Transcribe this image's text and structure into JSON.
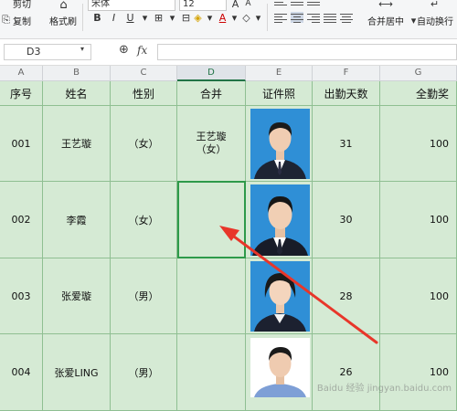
{
  "ribbon": {
    "cut_label": "剪切",
    "copy_label": "复制",
    "format_painter_label": "格式刷",
    "font_name": "宋体",
    "font_size": "12",
    "merge_center_label": "合并居中",
    "auto_wrap_label": "自动换行"
  },
  "formula_bar": {
    "name_box": "D3",
    "fx_symbol": "fx",
    "formula": ""
  },
  "columns": [
    "A",
    "B",
    "C",
    "D",
    "E",
    "F",
    "G"
  ],
  "table": {
    "headers": [
      "序号",
      "姓名",
      "性别",
      "合并",
      "证件照",
      "出勤天数",
      "全勤奖"
    ],
    "rows": [
      {
        "id": "001",
        "name": "王艺璇",
        "gender": "（女）",
        "merged": "王艺璇\n（女）",
        "days": "31",
        "bonus": "100"
      },
      {
        "id": "002",
        "name": "李霞",
        "gender": "（女）",
        "merged": "",
        "days": "30",
        "bonus": "100"
      },
      {
        "id": "003",
        "name": "张爱璇",
        "gender": "（男）",
        "merged": "",
        "days": "28",
        "bonus": "100"
      },
      {
        "id": "004",
        "name": "张爱LING",
        "gender": "（男）",
        "merged": "",
        "days": "26",
        "bonus": "100"
      }
    ]
  },
  "colors": {
    "cell_fill": "#d5ead4",
    "selection": "#2e9a4a",
    "arrow": "#e8362a",
    "photo_bg_blue": "#2f8fd6",
    "photo_bg_white": "#ffffff"
  },
  "watermark": "Baidu 经验  jingyan.baidu.com"
}
